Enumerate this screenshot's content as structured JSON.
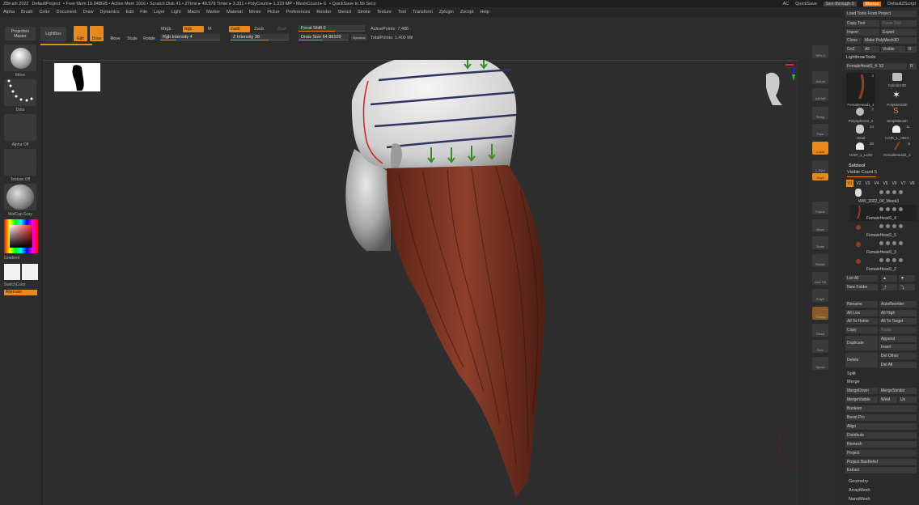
{
  "titlebar": {
    "items": [
      "ZBrush 2022",
      "DefaultProject",
      "• Free Mem 15.048GB • Active Mem 1916 • Scratch Disk 41 • ZTime ▸ 49.578 Timer ▸ 3.331 • PolyCount ▸ 1.323 MP • MeshCount ▸ 6",
      "• QuickSave In 56 Secs"
    ],
    "ac": "AC",
    "quicksave": "QuickSave",
    "seethrough": "See-through  0",
    "menus": "Menus",
    "script": "DefaultZScript"
  },
  "menubar": [
    "Alpha",
    "Brush",
    "Color",
    "Document",
    "Draw",
    "Dynamics",
    "Edit",
    "File",
    "Layer",
    "Light",
    "Macro",
    "Marker",
    "Material",
    "Movie",
    "Picker",
    "Preferences",
    "Render",
    "Stencil",
    "Stroke",
    "Texture",
    "Tool",
    "Transform",
    "Zplugin",
    "Zscript",
    "Help"
  ],
  "topshelf": {
    "projection_master": "Projection Master",
    "lightbox": "LightBox",
    "edit": "Edit",
    "draw": "Draw",
    "move": "Move",
    "scale": "Scale",
    "rotate": "Rotate",
    "mrgb": "Mrgb",
    "rgb": "Rgb",
    "m": "M",
    "rgb_intensity": "Rgb Intensity 4",
    "zadd": "Zadd",
    "zsub": "Zsub",
    "zcut": "Zcut",
    "z_intensity": "Z Intensity 38",
    "focal_shift": "Focal Shift 0",
    "draw_size": "Draw Size 64.88109",
    "dynamic": "Dynamic",
    "active_points": "ActivePoints: 7,486",
    "total_points": "TotalPoints: 1.400 Mil"
  },
  "leftshelf": {
    "move": "Move",
    "dots": "Dots",
    "alpha_off": "Alpha Off",
    "texture_off": "Texture Off",
    "matcap": "MatCap Gray",
    "gradient": "Gradient",
    "switchcolor": "SwitchColor",
    "alternate": "Alternate"
  },
  "rightshelf": [
    "SPix 3",
    "Actual",
    "AAHalf",
    "Persp",
    "Floor",
    "Local",
    "L.Sym",
    "Gxyz",
    "Frame",
    "Move",
    "Scale",
    "Rotate",
    "Line Fill",
    "PolyF",
    "Transp",
    "Ghost",
    "Solo",
    "Xpose"
  ],
  "palette": {
    "load_tools": "Load Tools From Project",
    "copy_tool": "Copy Tool",
    "paste_tool": "Paste Tool",
    "import": "Import",
    "export": "Export",
    "clone": "Clone",
    "make_polymesh": "Make PolyMesh3D",
    "goz": "GoZ",
    "all": "All",
    "visible": "Visible",
    "r": "R",
    "lightbox_tools": "Lightbox▸Tools",
    "current_tool": "FemaleHead1_4. 52",
    "current_tool_r": "R",
    "thumbs": [
      {
        "name": "FemaleHead1_4",
        "count": "3"
      },
      {
        "name": "Cylinder3D",
        "count": ""
      },
      {
        "name": "PolyMesh3D",
        "count": ""
      },
      {
        "name": "PolySphere2_2",
        "count": "7"
      },
      {
        "name": "SimpleBrush",
        "count": ""
      },
      {
        "name": "Head",
        "count": "24"
      },
      {
        "name": "HAIR_1_HIGH",
        "count": "11"
      },
      {
        "name": "HAIR_1_LOW",
        "count": "20"
      },
      {
        "name": "FemaleHead1_4",
        "count": "8"
      }
    ],
    "subtool": "Subtool",
    "visible_count": "Visible Count 5",
    "vtabs": [
      "V1",
      "V2",
      "V3",
      "V4",
      "V5",
      "V6",
      "V7",
      "V8"
    ],
    "subtools": [
      "WW_2022_04_Week3",
      "FemaleHead1_4",
      "FemaleHead1_5",
      "FemaleHead1_3",
      "FemaleHead1_2"
    ],
    "list_all": "List All",
    "new_folder": "New Folder",
    "buttons": [
      [
        "Rename",
        "AutoReorder"
      ],
      [
        "All Low",
        "All High"
      ],
      [
        "All To Home",
        "All To Target"
      ],
      [
        "Copy",
        "Paste"
      ],
      [
        "",
        "Append"
      ],
      [
        "Duplicate",
        "Insert"
      ],
      [
        "",
        "Del Other"
      ],
      [
        "Delete",
        "Del All"
      ]
    ],
    "split": "Split",
    "merge": "Merge",
    "merge_buttons": [
      [
        "MergeDown",
        "MergeSimilar"
      ],
      [
        "MergeVisible",
        "Weld",
        "Uv"
      ]
    ],
    "menu_items": [
      "Boolean",
      "Bevel Pro",
      "Align",
      "Distribute",
      "Remesh",
      "Project",
      "Project BasRelief",
      "Extract"
    ],
    "sections": [
      "Geometry",
      "ArrayMesh",
      "NanoMesh"
    ]
  },
  "colors": {
    "accent": "#e8891e",
    "hair": "#7a3322",
    "head": "#a9a9a9"
  }
}
